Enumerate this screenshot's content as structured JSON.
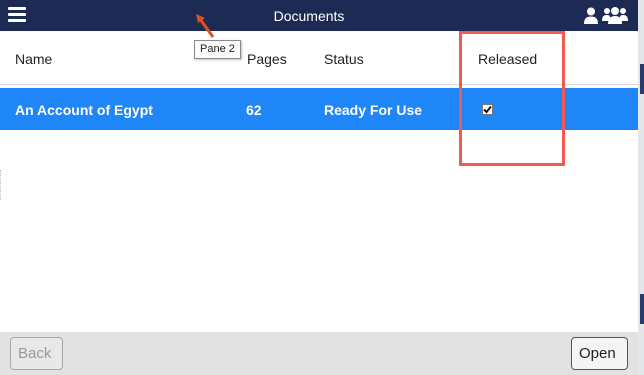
{
  "header": {
    "title": "Documents",
    "menu_icon": "hamburger-menu-icon",
    "user_icon": "user-icon",
    "users_icon": "users-group-icon",
    "background": "#1c2a54"
  },
  "annotation": {
    "tooltip": "Pane 2",
    "arrow_color": "#e0501e",
    "highlight_color": "#f05a50"
  },
  "table": {
    "columns": [
      "Name",
      "Pages",
      "Status",
      "Released"
    ],
    "rows": [
      {
        "name": "An Account of Egypt",
        "pages": "62",
        "status": "Ready For Use",
        "released": true
      }
    ],
    "selected_row_color": "#1e86f7"
  },
  "footer": {
    "back_label": "Back",
    "open_label": "Open"
  }
}
